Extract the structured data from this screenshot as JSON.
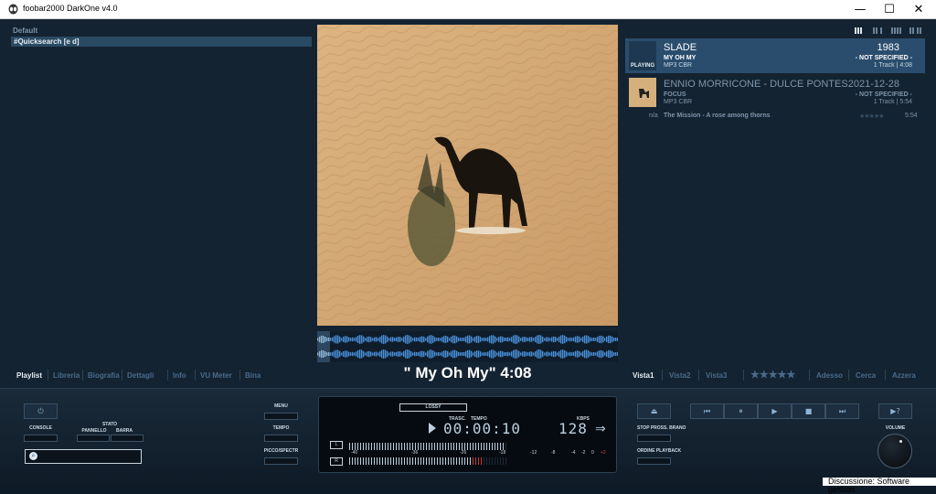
{
  "window": {
    "title": "foobar2000 DarkOne v4.0",
    "minimize": "—",
    "maximize": "☐",
    "close": "✕"
  },
  "left_panel": {
    "group_label": "Default",
    "playlist_name": "#Quicksearch [e d]"
  },
  "now_playing": {
    "caption": "\" My Oh My\" 4:08"
  },
  "left_tabs": [
    "Playlist",
    "Libreria",
    "Biografia",
    "Dettagli",
    "Info",
    "VU Meter",
    "Bina"
  ],
  "right_tabs": [
    "Vista1",
    "Vista2",
    "Vista3",
    "★★★★★",
    "Adesso",
    "Cerca",
    "Azzera"
  ],
  "playlist_groups": [
    {
      "artist": "SLADE",
      "album": "MY OH MY",
      "format": "MP3 CBR",
      "year": "1983",
      "genre": "- NOT SPECIFIED -",
      "tracks": "1 Track | 4:08",
      "state": "PLAYING"
    },
    {
      "artist": "ENNIO MORRICONE - DULCE PONTES",
      "album": "FOCUS",
      "format": "MP3 CBR",
      "year": "2021-12-28",
      "genre": "- NOT SPECIFIED -",
      "tracks": "1 Track | 5:54",
      "state": ""
    }
  ],
  "track_row": {
    "number": "n/a",
    "title": "The Mission - A rose among thorns",
    "rating": "★★★★★",
    "duration": "5:54"
  },
  "controls": {
    "console_label": "CONSOLE",
    "stato_label": "STATO",
    "pannello_label": "PANNELLO",
    "barra_label": "BARRA",
    "menu_label": "MENU",
    "tempo_label": "TEMPO",
    "picco_label": "PICCO/SPECTR",
    "stop_label": "STOP PROSS. BRANO",
    "order_label": "ORDINE PLAYBACK",
    "volume_label": "VOLUME",
    "power_icon": "⏻",
    "eject_icon": "⏏",
    "prev_icon": "⏮",
    "pause_icon": "⏸",
    "play_icon": "▶",
    "stop_icon": "■",
    "next_icon": "⏭",
    "rand_icon": "▶?"
  },
  "display": {
    "codec": "LOSSY",
    "trasc_label": "TRASC.",
    "tempo_label": "TEMPO",
    "time": "00:00:10",
    "kbps_label": "KBPS",
    "bitrate": "128",
    "left_channel": "L",
    "right_channel": "R",
    "scale": [
      "-40",
      "-36",
      "-26",
      "-18",
      "-12",
      "-8",
      "-4",
      "-2",
      "0",
      "+2"
    ]
  },
  "status_bar": {
    "text": "Discussione: Software gestion"
  },
  "colors": {
    "background": "#142331",
    "accent": "#2a4d6d",
    "active_text": "#e6eef4",
    "inactive_tab": "#4a6b8c"
  }
}
